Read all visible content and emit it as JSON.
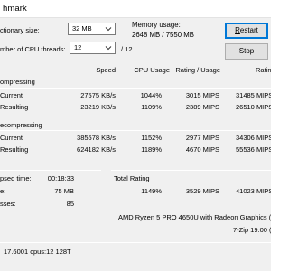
{
  "window": {
    "title": "hmark"
  },
  "settings": {
    "dictionary_label": "ctionary size:",
    "dictionary_value": "32 MB",
    "threads_label": "mber of CPU threads:",
    "threads_value": "12",
    "threads_total": "/ 12",
    "memory_label": "Memory usage:",
    "memory_value": "2648 MB / 7550 MB"
  },
  "buttons": {
    "restart_underlined": "R",
    "restart_rest": "estart",
    "stop_label": "Stop"
  },
  "columns": {
    "speed": "Speed",
    "cpu_usage": "CPU Usage",
    "rating_usage": "Rating / Usage",
    "rating": "Ratin"
  },
  "compressing": {
    "heading": "ompressing",
    "rows": [
      {
        "label": "Current",
        "speed": "27575 KB/s",
        "cpu": "1044%",
        "rating_usage": "3015 MIPS",
        "rating": "31485 MIPS"
      },
      {
        "label": "Resulting",
        "speed": "23219 KB/s",
        "cpu": "1109%",
        "rating_usage": "2389 MIPS",
        "rating": "26510 MIPS"
      }
    ]
  },
  "decompressing": {
    "heading": "ecompressing",
    "rows": [
      {
        "label": "Current",
        "speed": "385578 KB/s",
        "cpu": "1152%",
        "rating_usage": "2977 MIPS",
        "rating": "34306 MIPS"
      },
      {
        "label": "Resulting",
        "speed": "624182 KB/s",
        "cpu": "1189%",
        "rating_usage": "4670 MIPS",
        "rating": "55536 MIPS"
      }
    ]
  },
  "stats": {
    "elapsed_label": "psed time:",
    "elapsed_value": "00:18:33",
    "size_label": "e:",
    "size_value": "75 MB",
    "passes_label": "sses:",
    "passes_value": "85"
  },
  "total": {
    "label": "Total Rating",
    "cpu": "1149%",
    "rating_usage": "3529 MIPS",
    "rating": "41023 MIPS"
  },
  "system": {
    "cpu_name": "AMD Ryzen 5 PRO 4650U with Radeon Graphics (860F",
    "version": "7-Zip 19.00 (x",
    "footer": "17.6001 cpus:12 128T"
  }
}
